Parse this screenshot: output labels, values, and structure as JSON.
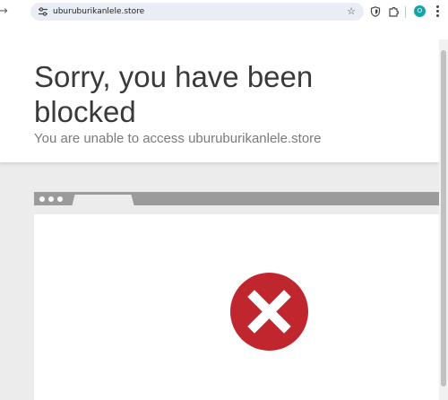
{
  "browser": {
    "url": "uburuburikanlele.store",
    "profile_initial": "O"
  },
  "page": {
    "heading": "Sorry, you have been blocked",
    "subheading": "You are unable to access uburuburikanlele.store"
  },
  "colors": {
    "blocked_icon": "#c0262d",
    "mock_bar": "#9b9b9b",
    "page_background": "#ececec"
  },
  "icons": {
    "site_settings": "tune-icon",
    "bookmark": "star-icon",
    "extension": "shield-icon",
    "extensions_menu": "puzzle-icon",
    "menu": "kebab-menu-icon",
    "blocked": "x-circle-icon"
  }
}
